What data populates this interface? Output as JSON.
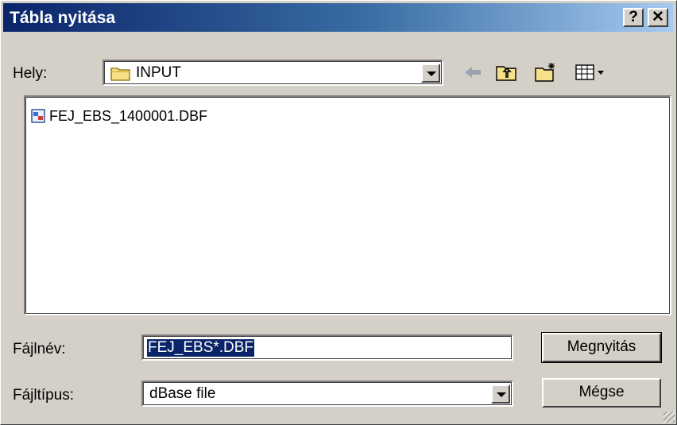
{
  "window": {
    "title": "Tábla nyitása",
    "help_label": "?",
    "close_label": "✕"
  },
  "location": {
    "label": "Hely:",
    "value": "INPUT"
  },
  "toolbar": {
    "back_icon": "back-arrow-icon",
    "up_icon": "up-folder-icon",
    "new_folder_icon": "new-folder-icon",
    "view_icon": "view-menu-icon"
  },
  "files": [
    {
      "name": "FEJ_EBS_1400001.DBF",
      "icon": "dbf-file-icon"
    }
  ],
  "filename": {
    "label": "Fájlnév:",
    "value": "FEJ_EBS*.DBF"
  },
  "filetype": {
    "label": "Fájltípus:",
    "value": "dBase file"
  },
  "buttons": {
    "open": "Megnyitás",
    "cancel": "Mégse"
  }
}
